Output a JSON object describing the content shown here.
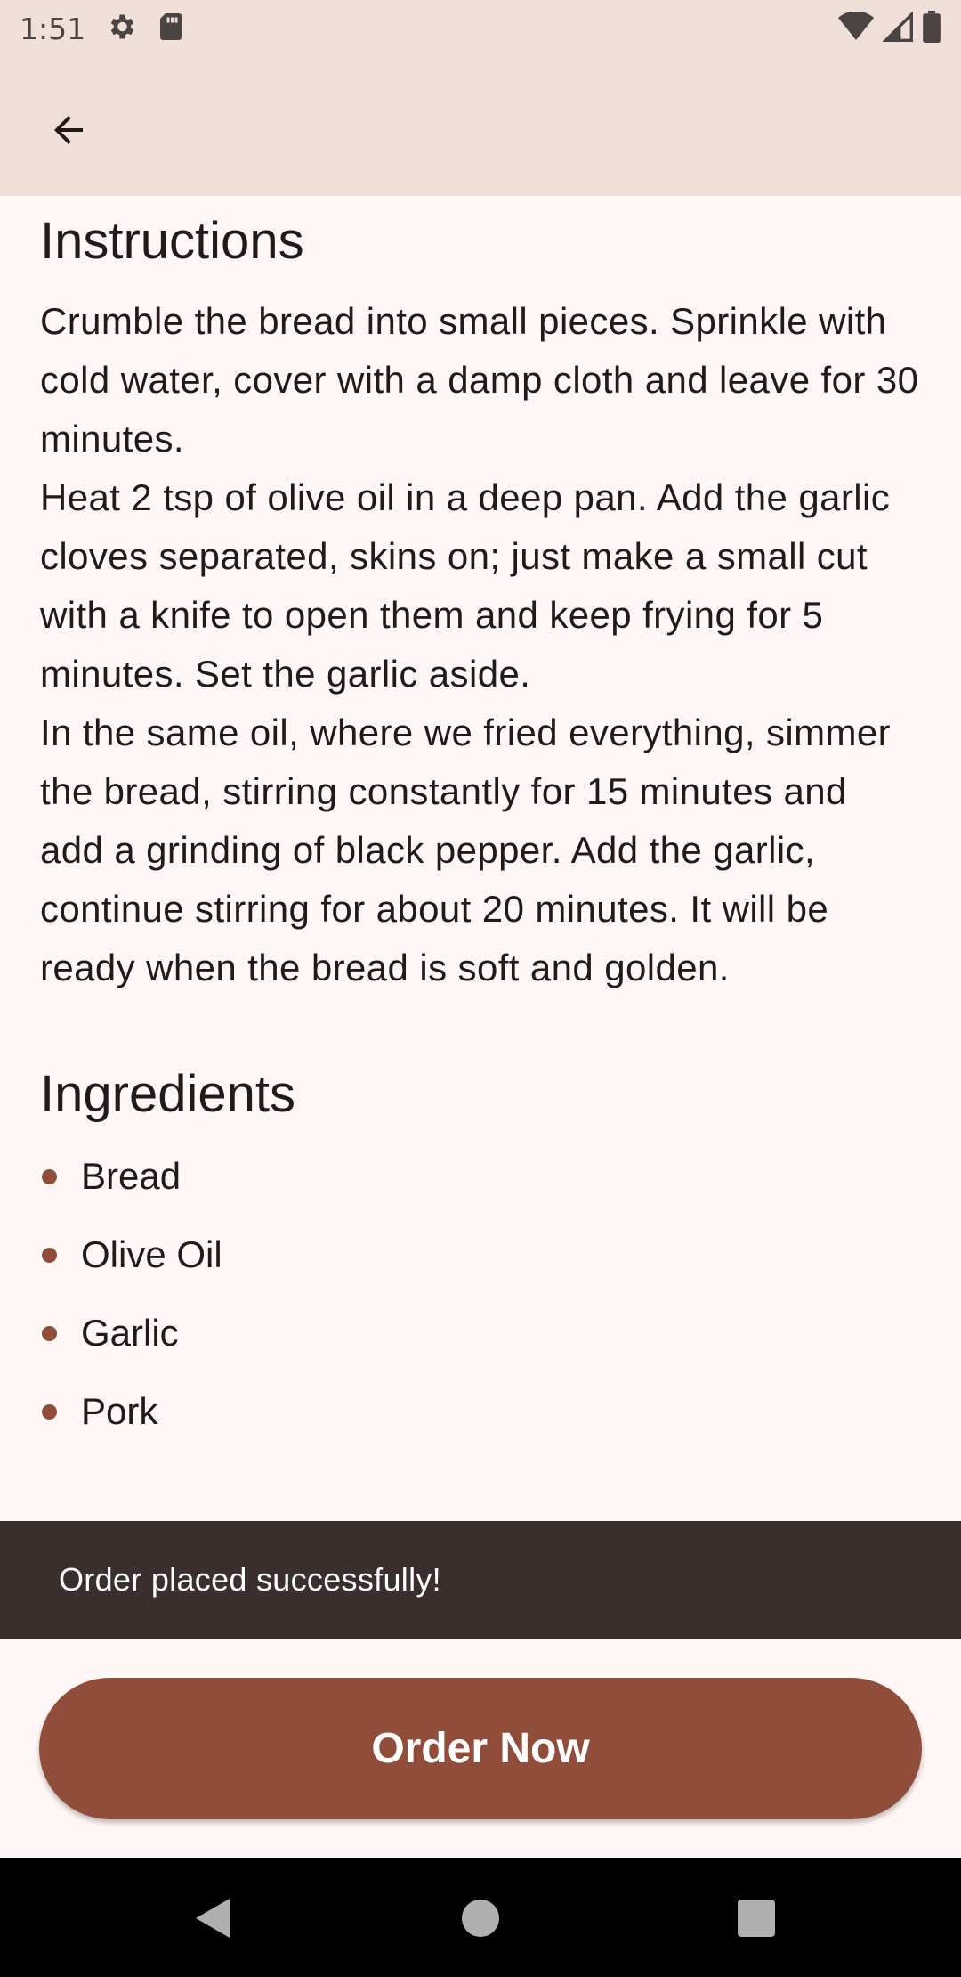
{
  "status_bar": {
    "time": "1:51",
    "left_icons": [
      "gear-icon",
      "sd-card-icon"
    ],
    "right_icons": [
      "wifi-icon",
      "signal-icon",
      "battery-icon"
    ]
  },
  "app_bar": {
    "back_icon": "arrow-left-icon"
  },
  "instructions": {
    "title": "Instructions",
    "text": "Crumble the bread into small pieces. Sprinkle with cold water, cover with a damp cloth and leave for 30 minutes.\nHeat 2 tsp of olive oil in a deep pan. Add the garlic cloves separated, skins on; just make a small cut with a knife to open them and keep frying for 5 minutes. Set the garlic aside.\nIn the same oil, where we fried everything, simmer the bread, stirring constantly for 15 minutes and add a grinding of black pepper. Add the garlic, continue stirring for about 20 minutes. It will be ready when the bread is soft and golden."
  },
  "ingredients": {
    "title": "Ingredients",
    "items": [
      "Bread",
      "Olive Oil",
      "Garlic",
      "Pork"
    ]
  },
  "snackbar": {
    "message": "Order placed successfully!"
  },
  "order_button": {
    "label": "Order Now"
  },
  "colors": {
    "primary": "#8f4d3a",
    "header_bg": "#f1dfd9",
    "surface": "#fff7f5",
    "snackbar_bg": "#3b2f2e"
  },
  "nav_bar": {
    "icons": [
      "back-triangle-icon",
      "home-circle-icon",
      "recents-square-icon"
    ]
  }
}
